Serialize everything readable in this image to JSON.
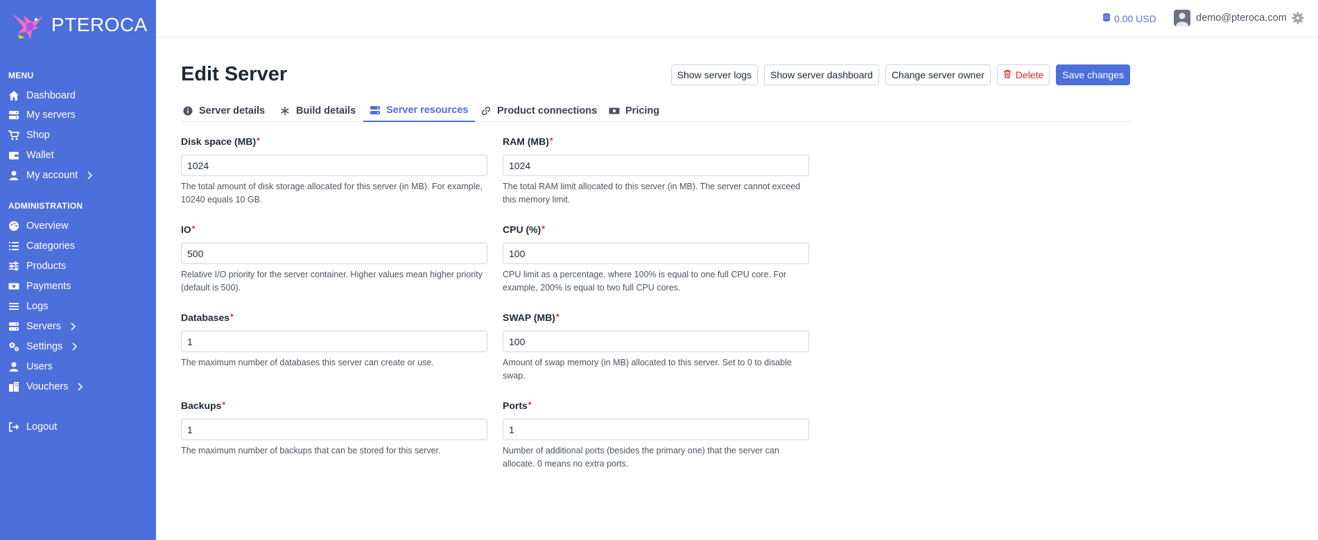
{
  "brand": {
    "name": "PTEROCA"
  },
  "sidebar": {
    "menu_title": "MENU",
    "menu_items": [
      {
        "label": "Dashboard",
        "icon": "home-icon"
      },
      {
        "label": "My servers",
        "icon": "server-icon"
      },
      {
        "label": "Shop",
        "icon": "cart-icon"
      },
      {
        "label": "Wallet",
        "icon": "wallet-icon"
      },
      {
        "label": "My account",
        "icon": "user-icon",
        "has_submenu": true
      }
    ],
    "admin_title": "ADMINISTRATION",
    "admin_items": [
      {
        "label": "Overview",
        "icon": "palette-icon"
      },
      {
        "label": "Categories",
        "icon": "list-icon"
      },
      {
        "label": "Products",
        "icon": "sliders-icon"
      },
      {
        "label": "Payments",
        "icon": "money-icon"
      },
      {
        "label": "Logs",
        "icon": "lines-icon"
      },
      {
        "label": "Servers",
        "icon": "server-icon",
        "has_submenu": true
      },
      {
        "label": "Settings",
        "icon": "gears-icon",
        "has_submenu": true
      },
      {
        "label": "Users",
        "icon": "user-icon"
      },
      {
        "label": "Vouchers",
        "icon": "building-icon",
        "has_submenu": true
      }
    ],
    "logout_label": "Logout"
  },
  "topbar": {
    "balance": "0.00 USD",
    "user_email": "demo@pteroca.com"
  },
  "page": {
    "title": "Edit Server",
    "actions": {
      "show_logs": "Show server logs",
      "show_dashboard": "Show server dashboard",
      "change_owner": "Change server owner",
      "delete": "Delete",
      "save": "Save changes"
    },
    "tabs": [
      {
        "label": "Server details",
        "icon": "info-icon",
        "active": false
      },
      {
        "label": "Build details",
        "icon": "asterisk-icon",
        "active": false
      },
      {
        "label": "Server resources",
        "icon": "server-icon",
        "active": true
      },
      {
        "label": "Product connections",
        "icon": "link-icon",
        "active": false
      },
      {
        "label": "Pricing",
        "icon": "money-icon",
        "active": false
      }
    ]
  },
  "fields": {
    "disk": {
      "label": "Disk space (MB)",
      "value": "1024",
      "help": "The total amount of disk storage allocated for this server (in MB). For example, 10240 equals 10 GB."
    },
    "ram": {
      "label": "RAM (MB)",
      "value": "1024",
      "help": "The total RAM limit allocated to this server (in MB). The server cannot exceed this memory limit."
    },
    "io": {
      "label": "IO",
      "value": "500",
      "help": "Relative I/O priority for the server container. Higher values mean higher priority (default is 500)."
    },
    "cpu": {
      "label": "CPU (%)",
      "value": "100",
      "help": "CPU limit as a percentage, where 100% is equal to one full CPU core. For example, 200% is equal to two full CPU cores."
    },
    "databases": {
      "label": "Databases",
      "value": "1",
      "help": "The maximum number of databases this server can create or use."
    },
    "swap": {
      "label": "SWAP (MB)",
      "value": "100",
      "help": "Amount of swap memory (in MB) allocated to this server. Set to 0 to disable swap."
    },
    "backups": {
      "label": "Backups",
      "value": "1",
      "help": "The maximum number of backups that can be stored for this server."
    },
    "ports": {
      "label": "Ports",
      "value": "1",
      "help": "Number of additional ports (besides the primary one) that the server can allocate. 0 means no extra ports."
    }
  },
  "required_mark": "*",
  "colors": {
    "sidebar": "#4c6fdc",
    "accent": "#4c6fdc",
    "danger": "#dc2626"
  }
}
